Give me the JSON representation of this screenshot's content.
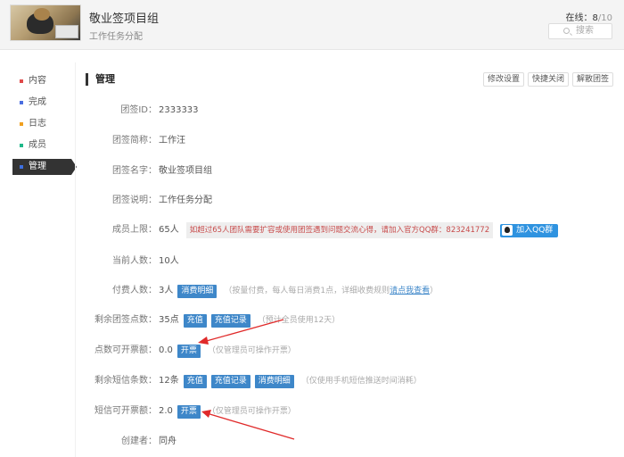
{
  "header": {
    "team_name": "敬业签项目组",
    "team_desc": "工作任务分配",
    "online_label": "在线：",
    "online_count": "8",
    "online_max": "/10",
    "search_label": "搜索"
  },
  "sidebar": {
    "items": [
      {
        "label": "内容",
        "color": "#e04a4a"
      },
      {
        "label": "完成",
        "color": "#4a6ee0"
      },
      {
        "label": "日志",
        "color": "#f0a020"
      },
      {
        "label": "成员",
        "color": "#1fb889"
      },
      {
        "label": "管理",
        "color": "#3d6fe0"
      }
    ],
    "active_index": 4
  },
  "panel": {
    "title": "管理",
    "tools": [
      "修改设置",
      "快捷关闭",
      "解散团签"
    ]
  },
  "fields": {
    "team_id": {
      "label": "团签ID：",
      "value": "2333333"
    },
    "short_name": {
      "label": "团签简称：",
      "value": "工作汪"
    },
    "full_name": {
      "label": "团签名字：",
      "value": "敬业签项目组"
    },
    "description": {
      "label": "团签说明：",
      "value": "工作任务分配"
    },
    "member_limit": {
      "label": "成员上限：",
      "value": "65人",
      "notice": "如超过65人团队需要扩容或使用团签遇到问题交流心得，请加入官方QQ群：823241772",
      "qq_button": "加入QQ群"
    },
    "current_count": {
      "label": "当前人数：",
      "value": "10人"
    },
    "paid_count": {
      "label": "付费人数：",
      "value": "3人",
      "button": "消费明细",
      "hint_prefix": "（按量付费，每人每日消费1点，详细收费规则",
      "hint_link": "请点我查看",
      "hint_suffix": "）"
    },
    "remaining_points": {
      "label": "剩余团签点数：",
      "value": "35点",
      "button1": "充值",
      "button2": "充值记录",
      "hint": "（预计全员使用12天）"
    },
    "point_invoice": {
      "label": "点数可开票额：",
      "value": "0.0",
      "button": "开票",
      "hint": "（仅管理员可操作开票）"
    },
    "remaining_sms": {
      "label": "剩余短信条数：",
      "value": "12条",
      "button1": "充值",
      "button2": "充值记录",
      "button3": "消费明细",
      "hint": "（仅使用手机短信推送时间消耗）"
    },
    "sms_invoice": {
      "label": "短信可开票额：",
      "value": "2.0",
      "button": "开票",
      "hint": "（仅管理员可操作开票）"
    },
    "creator": {
      "label": "创建者：",
      "value": "同舟"
    }
  },
  "colors": {
    "accent_blue": "#3e87c9",
    "notice_red": "#c84b4b",
    "arrow_red": "#e02a2a"
  }
}
